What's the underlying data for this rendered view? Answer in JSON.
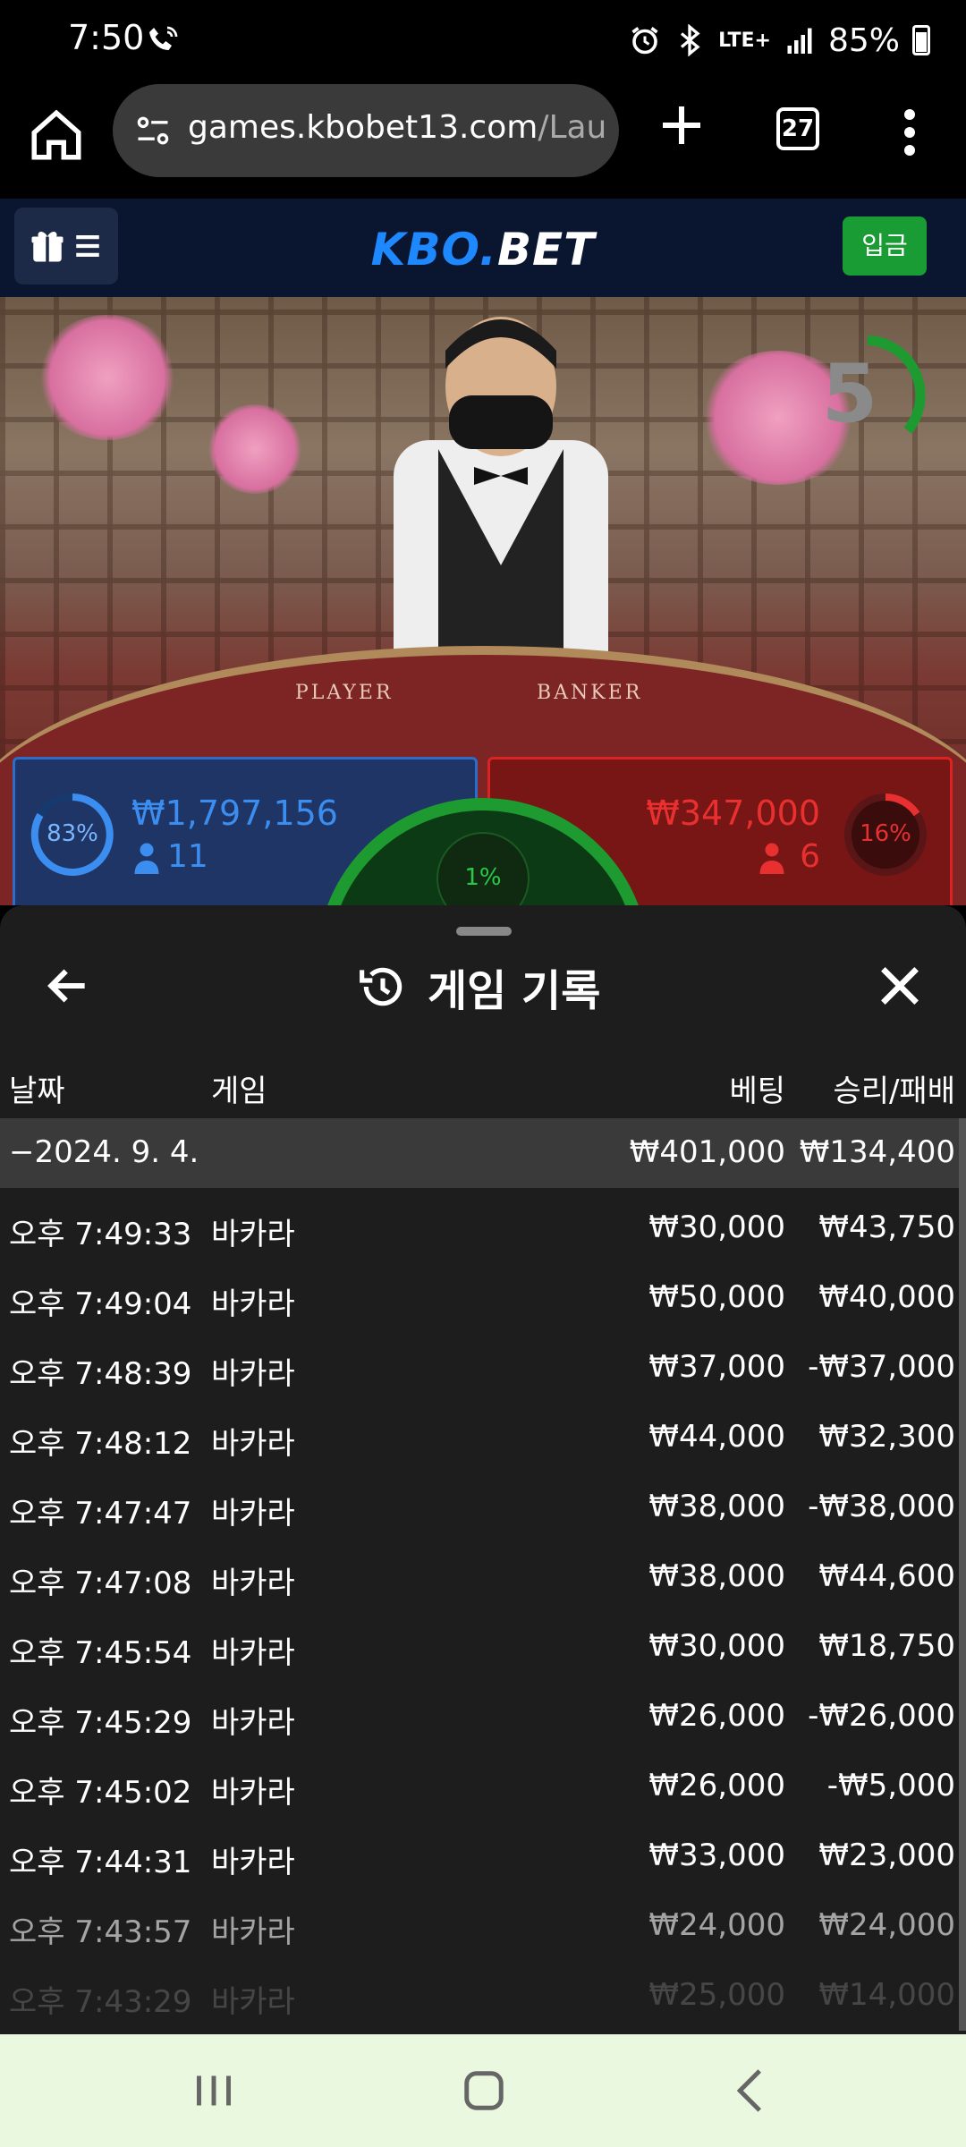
{
  "status_bar": {
    "time": "7:50",
    "network": "LTE+",
    "battery": "85%",
    "icons": [
      "wifi-call-icon",
      "alarm-icon",
      "bluetooth-icon",
      "lte-icon",
      "signal-icon",
      "battery-icon"
    ]
  },
  "browser": {
    "url_host": "games.kbobet13.com",
    "url_path": "/Laun",
    "tab_count": "27"
  },
  "site": {
    "logo_part1": "KBO.",
    "logo_part2": "BET",
    "deposit_label": "입금"
  },
  "game": {
    "countdown": "5",
    "table_player_label": "PLAYER",
    "table_banker_label": "BANKER",
    "player": {
      "percent": "83%",
      "amount": "₩1,797,156",
      "count": "11"
    },
    "banker": {
      "percent": "16%",
      "amount": "₩347,000",
      "count": "6"
    },
    "tie_percent": "1%",
    "colors": {
      "player": "#2d6cc8",
      "banker": "#dd2222",
      "tie": "#1e9b30"
    }
  },
  "history": {
    "title": "게임 기록",
    "headers": {
      "date": "날짜",
      "game": "게임",
      "bet": "베팅",
      "result": "승리/패배"
    },
    "summary": {
      "date": "−2024. 9. 4.",
      "bet": "₩401,000",
      "result": "₩134,400"
    },
    "rows": [
      {
        "time": "오후 7:49:33",
        "game": "바카라",
        "bet": "₩30,000",
        "result": "₩43,750"
      },
      {
        "time": "오후 7:49:04",
        "game": "바카라",
        "bet": "₩50,000",
        "result": "₩40,000"
      },
      {
        "time": "오후 7:48:39",
        "game": "바카라",
        "bet": "₩37,000",
        "result": "-₩37,000"
      },
      {
        "time": "오후 7:48:12",
        "game": "바카라",
        "bet": "₩44,000",
        "result": "₩32,300"
      },
      {
        "time": "오후 7:47:47",
        "game": "바카라",
        "bet": "₩38,000",
        "result": "-₩38,000"
      },
      {
        "time": "오후 7:47:08",
        "game": "바카라",
        "bet": "₩38,000",
        "result": "₩44,600"
      },
      {
        "time": "오후 7:45:54",
        "game": "바카라",
        "bet": "₩30,000",
        "result": "₩18,750"
      },
      {
        "time": "오후 7:45:29",
        "game": "바카라",
        "bet": "₩26,000",
        "result": "-₩26,000"
      },
      {
        "time": "오후 7:45:02",
        "game": "바카라",
        "bet": "₩26,000",
        "result": "-₩5,000"
      },
      {
        "time": "오후 7:44:31",
        "game": "바카라",
        "bet": "₩33,000",
        "result": "₩23,000"
      },
      {
        "time": "오후 7:43:57",
        "game": "바카라",
        "bet": "₩24,000",
        "result": "₩24,000"
      },
      {
        "time": "오후 7:43:29",
        "game": "바카라",
        "bet": "₩25,000",
        "result": "₩14,000"
      }
    ]
  },
  "nav": {
    "icons": [
      "recent-apps-icon",
      "home-icon",
      "back-icon"
    ]
  }
}
